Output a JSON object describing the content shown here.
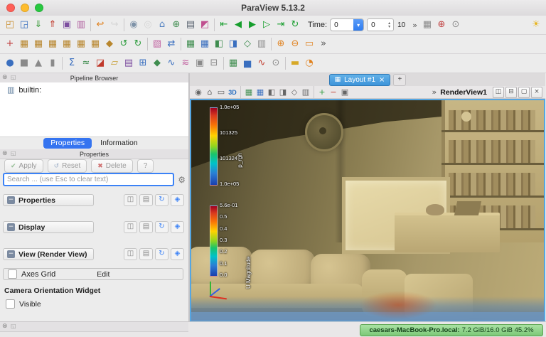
{
  "window": {
    "title": "ParaView 5.13.2"
  },
  "icons": {
    "dock-close": "⊗",
    "dock-undock": "◱",
    "gear": "⚙",
    "combo-arrow": "▾",
    "spin-up": "▴",
    "spin-down": "▾",
    "split-h": "◫",
    "split-v": "⊟",
    "detach": "▢",
    "close-x": "×",
    "server": "▥",
    "collapse-minus": "−",
    "copy": "◫",
    "paste": "▤",
    "restore": "↻",
    "save": "◈",
    "check": "✔",
    "reset-arrow": "↺",
    "delete-x": "✖",
    "layout-grid": "▦",
    "light-bulb": "☀"
  },
  "toolbar": {
    "time": {
      "label": "Time:",
      "value": "0",
      "frame": "0",
      "max": "10"
    },
    "overflow": "»",
    "row1": [
      {
        "n": "open-file",
        "g": "◰",
        "c": "#c98c2a"
      },
      {
        "n": "save-data",
        "g": "◲",
        "c": "#3a6fbf"
      },
      {
        "n": "load-state",
        "g": "⇓",
        "c": "#3f9d3f"
      },
      {
        "n": "save-state",
        "g": "⇑",
        "c": "#c0392b"
      },
      {
        "n": "save-screenshot",
        "g": "▣",
        "c": "#7d4fa0"
      },
      {
        "n": "save-animation",
        "g": "▥",
        "c": "#b05f9f"
      },
      {
        "sep": true
      },
      {
        "n": "undo",
        "g": "↩",
        "c": "#e0821f"
      },
      {
        "n": "redo",
        "g": "↪",
        "c": "#b9b9b9",
        "dis": true
      },
      {
        "sep": true
      },
      {
        "n": "camera-undo",
        "g": "◉",
        "c": "#7f93a8"
      },
      {
        "n": "camera-redo",
        "g": "◎",
        "c": "#b9b9b9",
        "dis": true
      },
      {
        "n": "reset-camera",
        "g": "⌂",
        "c": "#4f7fc0"
      },
      {
        "n": "zoom-to-data",
        "g": "⊕",
        "c": "#3f8d4f"
      },
      {
        "n": "capture-screenshot",
        "g": "▤",
        "c": "#5a6470"
      },
      {
        "n": "color-map-editor",
        "g": "◩",
        "c": "#c04f8f"
      },
      {
        "sep": true
      },
      {
        "n": "first-frame",
        "g": "⇤",
        "c": "#179e2d"
      },
      {
        "n": "previous-frame",
        "g": "◀",
        "c": "#179e2d"
      },
      {
        "n": "play",
        "g": "▶",
        "c": "#179e2d"
      },
      {
        "n": "next-frame",
        "g": "▷",
        "c": "#179e2d"
      },
      {
        "n": "last-frame",
        "g": "⇥",
        "c": "#179e2d"
      },
      {
        "n": "loop",
        "g": "↻",
        "c": "#179e2d"
      }
    ],
    "row1b": [
      {
        "n": "show-data-axes-grid",
        "g": "▦",
        "c": "#8a8a8a"
      },
      {
        "n": "show-center-of-rotation",
        "g": "⊕",
        "c": "#c04040"
      },
      {
        "n": "pick-center",
        "g": "⊙",
        "c": "#8a8a8a"
      }
    ],
    "row2": [
      {
        "n": "center-axes-visibility",
        "g": "+",
        "c": "#c04040"
      },
      {
        "n": "set-view-plus-x",
        "g": "▦",
        "c": "#b8862d"
      },
      {
        "n": "set-view-minus-x",
        "g": "▦",
        "c": "#b8862d"
      },
      {
        "n": "set-view-plus-y",
        "g": "▦",
        "c": "#b8862d"
      },
      {
        "n": "set-view-minus-y",
        "g": "▦",
        "c": "#b8862d"
      },
      {
        "n": "set-view-plus-z",
        "g": "▦",
        "c": "#b8862d"
      },
      {
        "n": "set-view-minus-z",
        "g": "▦",
        "c": "#b8862d"
      },
      {
        "n": "isometric-view",
        "g": "◆",
        "c": "#b8862d"
      },
      {
        "n": "rotate-90-ccw",
        "g": "↺",
        "c": "#2f9d3f"
      },
      {
        "n": "rotate-90-cw",
        "g": "↻",
        "c": "#2f9d3f"
      },
      {
        "sep": true
      },
      {
        "n": "edit-color-map",
        "g": "▧",
        "c": "#c05f9f"
      },
      {
        "n": "rescale-color-range",
        "g": "⇄",
        "c": "#3a6fbf"
      },
      {
        "sep": true
      },
      {
        "n": "select-surface-cells",
        "g": "▦",
        "c": "#3f8d4f"
      },
      {
        "n": "select-surface-points",
        "g": "▦",
        "c": "#3a6fbf"
      },
      {
        "n": "select-frustum-cells",
        "g": "◧",
        "c": "#3f8d4f"
      },
      {
        "n": "select-frustum-points",
        "g": "◨",
        "c": "#3a6fbf"
      },
      {
        "n": "select-polygon-cells",
        "g": "◇",
        "c": "#3f8d4f"
      },
      {
        "n": "select-block",
        "g": "▥",
        "c": "#8a8a8a"
      },
      {
        "sep": true
      },
      {
        "n": "zoom-in",
        "g": "⊕",
        "c": "#e0821f"
      },
      {
        "n": "zoom-out",
        "g": "⊖",
        "c": "#e0821f"
      },
      {
        "n": "zoom-to-box",
        "g": "▭",
        "c": "#e0821f"
      },
      {
        "n": "toolbar-overflow",
        "g": "»",
        "c": "#555555"
      }
    ],
    "row3": [
      {
        "n": "sphere-source",
        "g": "●",
        "c": "#3a6fbf"
      },
      {
        "n": "cube-source",
        "g": "■",
        "c": "#8a8a8a"
      },
      {
        "n": "cone-source",
        "g": "▲",
        "c": "#8a8a8a"
      },
      {
        "n": "cylinder-source",
        "g": "▮",
        "c": "#8a8a8a"
      },
      {
        "sep": true
      },
      {
        "n": "calculator-filter",
        "g": "Σ",
        "c": "#3a6fbf"
      },
      {
        "n": "contour-filter",
        "g": "≈",
        "c": "#3f8d4f"
      },
      {
        "n": "clip-filter",
        "g": "◪",
        "c": "#c0392b"
      },
      {
        "n": "slice-filter",
        "g": "▱",
        "c": "#c9a23c"
      },
      {
        "n": "threshold-filter",
        "g": "▤",
        "c": "#7d4fa0"
      },
      {
        "n": "extract-subset-filter",
        "g": "⊞",
        "c": "#3a6fbf"
      },
      {
        "n": "glyph-filter",
        "g": "◆",
        "c": "#3f8d4f"
      },
      {
        "n": "stream-tracer-filter",
        "g": "∿",
        "c": "#3a6fbf"
      },
      {
        "n": "warp-by-vector-filter",
        "g": "≋",
        "c": "#c05f9f"
      },
      {
        "n": "group-datasets-filter",
        "g": "▣",
        "c": "#8a8a8a"
      },
      {
        "n": "extract-block-filter",
        "g": "⊟",
        "c": "#8a8a8a"
      },
      {
        "sep": true
      },
      {
        "n": "spreadsheet-view",
        "g": "▦",
        "c": "#3f8d4f"
      },
      {
        "n": "histogram-view",
        "g": "▅",
        "c": "#3a6fbf"
      },
      {
        "n": "plot-over-line",
        "g": "∿",
        "c": "#c0392b"
      },
      {
        "n": "probe-location",
        "g": "⊙",
        "c": "#8a8a8a"
      },
      {
        "sep": true
      },
      {
        "n": "ruler",
        "g": "▬",
        "c": "#d7a928"
      },
      {
        "n": "protractor",
        "g": "◔",
        "c": "#e0821f"
      }
    ]
  },
  "pipeline": {
    "title": "Pipeline Browser",
    "items": [
      {
        "label": "builtin:"
      }
    ]
  },
  "panel_tabs": {
    "properties": "Properties",
    "information": "Information"
  },
  "properties": {
    "title": "Properties",
    "buttons": {
      "apply": "Apply",
      "reset": "Reset",
      "delete": "Delete",
      "help": "?"
    },
    "search_placeholder": "Search ... (use Esc to clear text)",
    "sections": [
      {
        "label": "Properties"
      },
      {
        "label": "Display"
      },
      {
        "label": "View (Render View)"
      }
    ],
    "axes_grid": {
      "label": "Axes Grid",
      "edit": "Edit"
    },
    "camera_widget": {
      "label": "Camera Orientation Widget",
      "visible": "Visible"
    }
  },
  "layout_bar": {
    "tab": "Layout #1",
    "close": "×",
    "add": "+"
  },
  "view": {
    "name": "RenderView1",
    "overflow": "»",
    "toolbar_icons": [
      {
        "n": "adjust-camera",
        "g": "◉",
        "c": "#666666"
      },
      {
        "n": "reset-view",
        "g": "⌂",
        "c": "#666666"
      },
      {
        "n": "zoom-view-to-box",
        "g": "▭",
        "c": "#666666"
      },
      {
        "n": "toggle-2d3d",
        "txt": "3D",
        "c": "#2a6fc0"
      },
      {
        "sep": true
      },
      {
        "n": "select-cells-on",
        "g": "▦",
        "c": "#3f8d4f"
      },
      {
        "n": "select-points-on",
        "g": "▦",
        "c": "#3a6fbf"
      },
      {
        "n": "select-cells-through",
        "g": "◧",
        "c": "#666666"
      },
      {
        "n": "select-points-through",
        "g": "◨",
        "c": "#666666"
      },
      {
        "n": "interactive-select-cells",
        "g": "◇",
        "c": "#666666"
      },
      {
        "n": "hover-cells",
        "g": "▥",
        "c": "#666666"
      },
      {
        "sep": true
      },
      {
        "n": "add-selection",
        "g": "+",
        "c": "#2f9d3f"
      },
      {
        "n": "subtract-selection",
        "g": "−",
        "c": "#c0392b"
      },
      {
        "n": "toggle-selection",
        "g": "▣",
        "c": "#666666"
      }
    ],
    "colorbars": [
      {
        "title": "p_rgh",
        "labels": [
          "1.0e+05",
          "101325",
          "101324",
          "1.0e+05"
        ]
      },
      {
        "title": "U Magnitude",
        "labels": [
          "5.6e-01",
          "0.5",
          "0.4",
          "0.3",
          "0.2",
          "0.1",
          "0.0"
        ]
      }
    ]
  },
  "status": {
    "host": "caesars-MacBook-Pro.local:",
    "memory": "7.2 GiB/16.0 GiB 45.2%"
  }
}
